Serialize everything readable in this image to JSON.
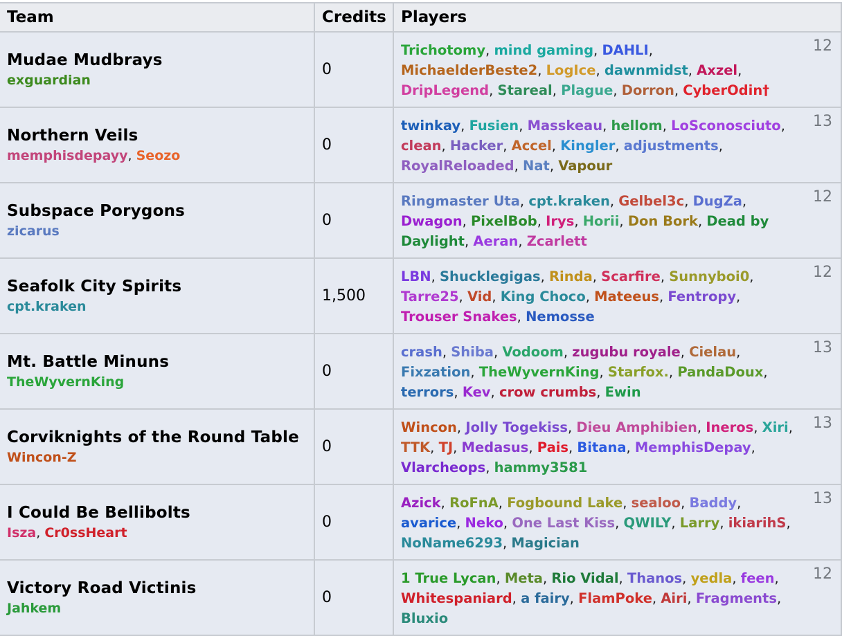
{
  "headers": {
    "team": "Team",
    "credits": "Credits",
    "players": "Players"
  },
  "teams": [
    {
      "name": "Mudae Mudbrays",
      "managers": [
        {
          "name": "exguardian",
          "color": "#3d8a1e"
        }
      ],
      "credits": "0",
      "count": "12",
      "players": [
        {
          "name": "Trichotomy",
          "color": "#2aa53a"
        },
        {
          "name": "mind gaming",
          "color": "#1ba9a0"
        },
        {
          "name": "DAHLI",
          "color": "#3a59e0"
        },
        {
          "name": "MichaelderBeste2",
          "color": "#b5651d"
        },
        {
          "name": "LogIce",
          "color": "#d19a2a"
        },
        {
          "name": "dawnmidst",
          "color": "#1f8f9e"
        },
        {
          "name": "Axzel",
          "color": "#c2185b"
        },
        {
          "name": "DripLegend",
          "color": "#d13fa0"
        },
        {
          "name": "Stareal",
          "color": "#2e8b57"
        },
        {
          "name": "Plague",
          "color": "#3aa88f"
        },
        {
          "name": "Dorron",
          "color": "#b0603a"
        },
        {
          "name": "CyberOdin†",
          "color": "#e0222c"
        }
      ]
    },
    {
      "name": "Northern Veils",
      "managers": [
        {
          "name": "memphisdepayy",
          "color": "#c2457a"
        },
        {
          "name": "Seozo",
          "color": "#e8632a"
        }
      ],
      "credits": "0",
      "count": "13",
      "players": [
        {
          "name": "twinkay",
          "color": "#1d5fb8"
        },
        {
          "name": "Fusien",
          "color": "#1fa5a0"
        },
        {
          "name": "Masskeau",
          "color": "#8a4fd0"
        },
        {
          "name": "hellom",
          "color": "#2e9a4a"
        },
        {
          "name": "LoSconosciuto",
          "color": "#a040e0"
        },
        {
          "name": "clean",
          "color": "#c23a5a"
        },
        {
          "name": "Hacker",
          "color": "#7a5fc0"
        },
        {
          "name": "Accel",
          "color": "#c0652a"
        },
        {
          "name": "Kingler",
          "color": "#2a8fd0"
        },
        {
          "name": "adjustments",
          "color": "#5a78d0"
        },
        {
          "name": "RoyalReloaded",
          "color": "#8f5fc0"
        },
        {
          "name": "Nat",
          "color": "#5a7fc0"
        },
        {
          "name": "Vapour",
          "color": "#7a6a1a"
        }
      ]
    },
    {
      "name": "Subspace Porygons",
      "managers": [
        {
          "name": "zicarus",
          "color": "#5a7ac0"
        }
      ],
      "credits": "0",
      "count": "12",
      "players": [
        {
          "name": "Ringmaster Uta",
          "color": "#5a7ac0"
        },
        {
          "name": "cpt.kraken",
          "color": "#2a8a9a"
        },
        {
          "name": "Gelbel3c",
          "color": "#c24a3a"
        },
        {
          "name": "DugZa",
          "color": "#5a6fd0"
        },
        {
          "name": "Dwagon",
          "color": "#9a1fd0"
        },
        {
          "name": "PixelBob",
          "color": "#2a8a2a"
        },
        {
          "name": "Irys",
          "color": "#d0207a"
        },
        {
          "name": "Horii",
          "color": "#3aa86a"
        },
        {
          "name": "Don Bork",
          "color": "#9a7a1a"
        },
        {
          "name": "Dead by Daylight",
          "color": "#1f8a3a"
        },
        {
          "name": "Aeran",
          "color": "#9a3ae0"
        },
        {
          "name": "Zcarlett",
          "color": "#c03aa0"
        }
      ]
    },
    {
      "name": "Seafolk City Spirits",
      "managers": [
        {
          "name": "cpt.kraken",
          "color": "#2a8a9a"
        }
      ],
      "credits": "1,500",
      "count": "12",
      "players": [
        {
          "name": "LBN",
          "color": "#7a3ae0"
        },
        {
          "name": "Shucklegigas",
          "color": "#2a7a9a"
        },
        {
          "name": "Rinda",
          "color": "#c0901a"
        },
        {
          "name": "Scarfire",
          "color": "#d0305a"
        },
        {
          "name": "Sunnyboi0",
          "color": "#9a9a2a"
        },
        {
          "name": "Tarre25",
          "color": "#b03ad0"
        },
        {
          "name": "Vid",
          "color": "#c04a2a"
        },
        {
          "name": "King Choco",
          "color": "#2a8a9a"
        },
        {
          "name": "Mateeus",
          "color": "#c0501a"
        },
        {
          "name": "Fentropy",
          "color": "#7a4ad0"
        },
        {
          "name": "Trouser Snakes",
          "color": "#c020b0"
        },
        {
          "name": "Nemosse",
          "color": "#2a5ac0"
        }
      ]
    },
    {
      "name": "Mt. Battle Minuns",
      "managers": [
        {
          "name": "TheWyvernKing",
          "color": "#2aa53a"
        }
      ],
      "credits": "0",
      "count": "13",
      "players": [
        {
          "name": "crash",
          "color": "#5a6fd0"
        },
        {
          "name": "Shiba",
          "color": "#6a7ad0"
        },
        {
          "name": "Vodoom",
          "color": "#2aa56a"
        },
        {
          "name": "zugubu royale",
          "color": "#a0208a"
        },
        {
          "name": "Cielau",
          "color": "#b06a3a"
        },
        {
          "name": "Fixzation",
          "color": "#3a7ab0"
        },
        {
          "name": "TheWyvernKing",
          "color": "#2aa53a"
        },
        {
          "name": "Starfox.",
          "color": "#8aa02a"
        },
        {
          "name": "PandaDoux",
          "color": "#5a9a2a"
        },
        {
          "name": "terrors",
          "color": "#2a6ab0"
        },
        {
          "name": "Kev",
          "color": "#9a2ad0"
        },
        {
          "name": "crow crumbs",
          "color": "#c0203a"
        },
        {
          "name": "Ewin",
          "color": "#1f9a4a"
        }
      ]
    },
    {
      "name": "Corviknights of the Round Table",
      "managers": [
        {
          "name": "Wincon-Z",
          "color": "#c0501a"
        }
      ],
      "credits": "0",
      "count": "13",
      "players": [
        {
          "name": "Wincon",
          "color": "#c0501a"
        },
        {
          "name": "Jolly Togekiss",
          "color": "#7a4ad0"
        },
        {
          "name": "Dieu Amphibien",
          "color": "#c04a9a"
        },
        {
          "name": "Ineros",
          "color": "#d0207a"
        },
        {
          "name": "Xiri",
          "color": "#2aa59a"
        },
        {
          "name": "TTK",
          "color": "#c05a2a"
        },
        {
          "name": "TJ",
          "color": "#d0402a"
        },
        {
          "name": "Medasus",
          "color": "#8a3ad0"
        },
        {
          "name": "Pais",
          "color": "#e01a2a"
        },
        {
          "name": "Bitana",
          "color": "#2a5ae0"
        },
        {
          "name": "MemphisDepay",
          "color": "#8a4ae0"
        },
        {
          "name": "Vlarcheops",
          "color": "#7a2ad0"
        },
        {
          "name": "hammy3581",
          "color": "#2a9a4a"
        }
      ]
    },
    {
      "name": "I Could Be Bellibolts",
      "managers": [
        {
          "name": "Isza",
          "color": "#d0306a"
        },
        {
          "name": "Cr0ssHeart",
          "color": "#d0202a"
        }
      ],
      "credits": "0",
      "count": "13",
      "players": [
        {
          "name": "Azick",
          "color": "#9a20c0"
        },
        {
          "name": "RoFnA",
          "color": "#7a9a2a"
        },
        {
          "name": "Fogbound Lake",
          "color": "#9a9a2a"
        },
        {
          "name": "sealoo",
          "color": "#c05a4a"
        },
        {
          "name": "Baddy",
          "color": "#7a7ae0"
        },
        {
          "name": "avarice",
          "color": "#1a5ad0"
        },
        {
          "name": "Neko",
          "color": "#9a2ae0"
        },
        {
          "name": "One Last Kiss",
          "color": "#9a6ac0"
        },
        {
          "name": "QWILY",
          "color": "#2a9a7a"
        },
        {
          "name": "Larry",
          "color": "#7a9a2a"
        },
        {
          "name": "ikiarihS",
          "color": "#c03a4a"
        },
        {
          "name": "NoName6293",
          "color": "#2a8a9a"
        },
        {
          "name": "Magician",
          "color": "#2a7a8a"
        }
      ]
    },
    {
      "name": "Victory Road Victinis",
      "managers": [
        {
          "name": "Jahkem",
          "color": "#2a9a3a"
        }
      ],
      "credits": "0",
      "count": "12",
      "players": [
        {
          "name": "1 True Lycan",
          "color": "#2a9a2a"
        },
        {
          "name": "Meta",
          "color": "#5a8a2a"
        },
        {
          "name": "Rio Vidal",
          "color": "#1f7a3a"
        },
        {
          "name": "Thanos",
          "color": "#6a5ad0"
        },
        {
          "name": "yedla",
          "color": "#c0a01a"
        },
        {
          "name": "feen",
          "color": "#9a3ae0"
        },
        {
          "name": "Whitespaniard",
          "color": "#d0202a"
        },
        {
          "name": "a fairy",
          "color": "#2a6a9a"
        },
        {
          "name": "FlamPoke",
          "color": "#d0302a"
        },
        {
          "name": "Airi",
          "color": "#c03a3a"
        },
        {
          "name": "Fragments",
          "color": "#8a4ad0"
        },
        {
          "name": "Bluxio",
          "color": "#2a8a7a"
        }
      ]
    }
  ]
}
